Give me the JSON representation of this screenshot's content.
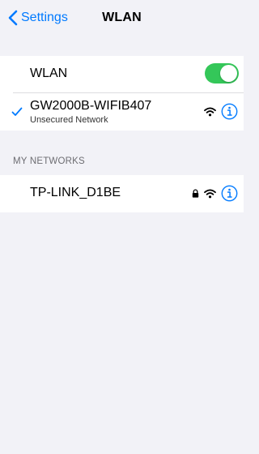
{
  "nav": {
    "back_label": "Settings",
    "title": "WLAN"
  },
  "wlan_toggle": {
    "label": "WLAN",
    "on": true,
    "color": "#34c759"
  },
  "connected_network": {
    "name": "GW2000B-WIFIB407",
    "subtitle": "Unsecured Network",
    "secured": false,
    "check_icon": "checkmark-icon",
    "wifi_icon": "wifi-icon",
    "info_icon": "info-icon"
  },
  "my_networks": {
    "header": "MY NETWORKS",
    "items": [
      {
        "name": "TP-LINK_D1BE",
        "secured": true,
        "lock_icon": "lock-icon",
        "wifi_icon": "wifi-icon",
        "info_icon": "info-icon"
      }
    ]
  },
  "colors": {
    "accent": "#007aff",
    "background": "#f2f2f7",
    "cell": "#ffffff",
    "separator": "#dcdce0",
    "section_header": "#6d6d72"
  }
}
